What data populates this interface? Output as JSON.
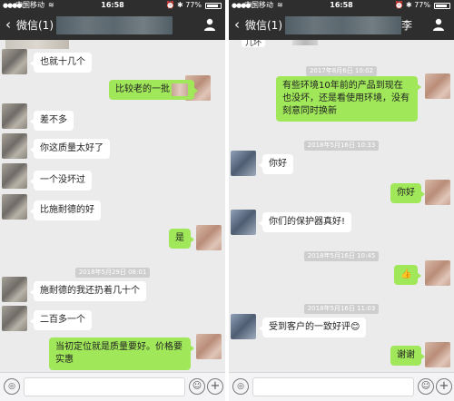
{
  "status": {
    "carrier": "中国移动",
    "time": "16:58",
    "battery": "77%"
  },
  "nav": {
    "back": "微信(1)",
    "contact_suffix": "李"
  },
  "left_chat": [
    {
      "side": "in",
      "text": "也就十几个"
    },
    {
      "side": "out",
      "text": "比较老的一批"
    },
    {
      "side": "in",
      "text": "差不多"
    },
    {
      "side": "in",
      "text": "你这质量太好了"
    },
    {
      "side": "in",
      "text": "一个没坏过"
    },
    {
      "side": "in",
      "text": "比施耐德的好"
    },
    {
      "side": "out",
      "text": "是"
    },
    {
      "side": "ts",
      "text": "2018年5月29日 08:01"
    },
    {
      "side": "in",
      "text": "施耐德的我还扔着几十个"
    },
    {
      "side": "in",
      "text": "二百多一个"
    },
    {
      "side": "out",
      "text": "当初定位就是质量要好。价格要实惠"
    }
  ],
  "right_chat": [
    {
      "side": "top",
      "text": "几坏"
    },
    {
      "side": "ts",
      "text": "2017年8月6日 10:02"
    },
    {
      "side": "out",
      "text": "有些环境10年前的产品到现在也没坏，还是看使用环境，没有刻意同时换新"
    },
    {
      "side": "ts",
      "text": "2018年5月16日 10:33"
    },
    {
      "side": "in",
      "text": "你好"
    },
    {
      "side": "out",
      "text": "你好"
    },
    {
      "side": "in",
      "text": "你们的保护器真好!"
    },
    {
      "side": "ts",
      "text": "2018年5月16日 10:45"
    },
    {
      "side": "out",
      "text": "👍"
    },
    {
      "side": "ts",
      "text": "2018年5月16日 11:03"
    },
    {
      "side": "in",
      "text": "受到客户的一致好评😊"
    },
    {
      "side": "out",
      "text": "谢谢"
    }
  ],
  "icons": [
    "signal-icon",
    "wifi-icon",
    "alarm-icon",
    "bluetooth-icon",
    "battery-icon",
    "back-chevron-icon",
    "person-icon",
    "voice-icon",
    "emoji-icon",
    "plus-icon"
  ],
  "colors": {
    "navbar": "#2e2e2e",
    "chat_bg": "#ebebeb",
    "bubble_out": "#a0e75a",
    "bubble_in": "#ffffff"
  }
}
